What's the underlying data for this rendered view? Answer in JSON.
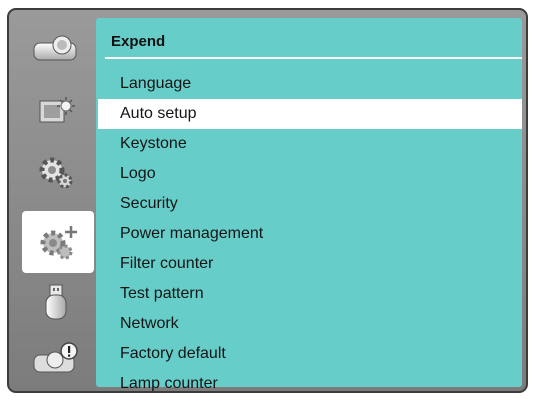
{
  "panel": {
    "title": "Expend",
    "items": [
      {
        "label": "Language"
      },
      {
        "label": "Auto setup"
      },
      {
        "label": "Keystone"
      },
      {
        "label": "Logo"
      },
      {
        "label": "Security"
      },
      {
        "label": "Power management"
      },
      {
        "label": "Filter counter"
      },
      {
        "label": "Test pattern"
      },
      {
        "label": "Network"
      },
      {
        "label": "Factory default"
      },
      {
        "label": "Lamp counter"
      }
    ],
    "selected_item": "Auto setup"
  },
  "sidebar": {
    "icons": [
      "projector-icon",
      "image-adjust-icon",
      "settings-gear-icon",
      "expand-gear-icon",
      "usb-icon",
      "projector-info-icon"
    ],
    "active_icon": "expand-gear-icon"
  },
  "colors": {
    "panel_background": "#66cdc9",
    "frame_background": "#8a8a8a",
    "selection_highlight": "#ffffff"
  }
}
